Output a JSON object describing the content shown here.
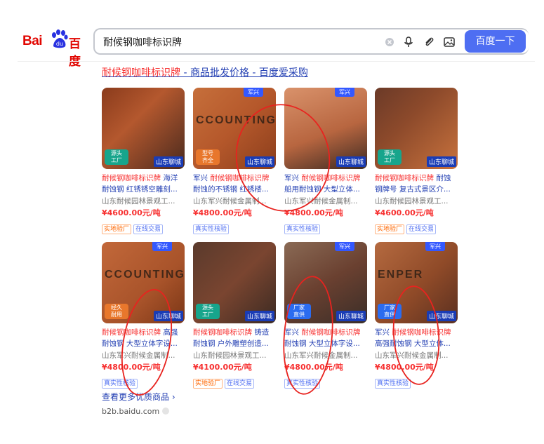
{
  "logo": {
    "bai": "Bai",
    "du": "百度"
  },
  "search": {
    "query": "耐候钢咖啡标识牌",
    "button_label": "百度一下"
  },
  "result": {
    "title_highlight": "耐候钢咖啡标识牌",
    "title_rest": " - 商品批发价格 - 百度爱采购"
  },
  "products": [
    {
      "top_tag": "",
      "badge": "源头\n工厂",
      "shop": "山东聊城",
      "desc_hl": "耐候钢咖啡标识牌",
      "desc_rest": " 海洋耐蚀钢 红锈锈空雕刻...",
      "company": "山东耐候园林景观工...",
      "price": "¥4600.00元/吨",
      "tags": [
        "实地验厂",
        "在线交易"
      ]
    },
    {
      "top_tag": "军兴",
      "badge": "型号\n齐全",
      "shop": "山东聊城",
      "desc_hl": "耐候钢咖啡标识牌",
      "desc_pre": "军兴 ",
      "desc_rest": " 耐蚀的不锈钢 红锈楼...",
      "company": "山东军兴耐候金属制...",
      "price": "¥4800.00元/吨",
      "tags": [
        "真实性核验"
      ]
    },
    {
      "top_tag": "军兴",
      "badge": "",
      "shop": "山东聊城",
      "desc_hl": "耐候钢咖啡标识牌",
      "desc_pre": "军兴 ",
      "desc_rest": " 船用耐蚀钢 大型立体...",
      "company": "山东军兴耐候金属制...",
      "price": "¥4800.00元/吨",
      "tags": [
        "真实性核验"
      ]
    },
    {
      "top_tag": "",
      "badge": "源头\n工厂",
      "shop": "山东聊城",
      "desc_hl": "耐候钢咖啡标识牌",
      "desc_rest": " 耐蚀钢牌号 复古式景区介...",
      "company": "山东耐候园林景观工...",
      "price": "¥4600.00元/吨",
      "tags": [
        "实地验厂",
        "在线交易"
      ]
    },
    {
      "top_tag": "军兴",
      "badge": "经久\n耐用",
      "shop": "山东聊城",
      "desc_hl": "耐候钢咖啡标识牌",
      "desc_rest": " 高强耐蚀钢 大型立体字设...",
      "company": "山东军兴耐候金属制...",
      "price": "¥4800.00元/吨",
      "tags": [
        "真实性核验"
      ]
    },
    {
      "top_tag": "",
      "badge": "源头\n工厂",
      "shop": "山东聊城",
      "desc_hl": "耐候钢咖啡标识牌",
      "desc_rest": " 铸造耐蚀钢 户外雕塑创造...",
      "company": "山东耐候园林景观工...",
      "price": "¥4100.00元/吨",
      "tags": [
        "实地验厂",
        "在线交易"
      ]
    },
    {
      "top_tag": "军兴",
      "badge": "厂家\n直供",
      "shop": "山东聊城",
      "desc_hl": "耐候钢咖啡标识牌",
      "desc_pre": "军兴 ",
      "desc_rest": " 耐蚀钢 大型立体字设...",
      "company": "山东军兴耐候金属制...",
      "price": "¥4800.00元/吨",
      "tags": [
        "真实性核验"
      ]
    },
    {
      "top_tag": "军兴",
      "badge": "厂家\n直供",
      "shop": "山东聊城",
      "desc_hl": "耐候钢咖啡标识牌",
      "desc_pre": "军兴 ",
      "desc_rest": " 高强耐蚀钢 大型立体...",
      "company": "山东军兴耐候金属制...",
      "price": "¥4800.00元/吨",
      "tags": [
        "真实性核验"
      ]
    }
  ],
  "footer": {
    "more": "查看更多优质商品 ›",
    "source": "b2b.baidu.com"
  },
  "colors": {
    "accent": "#4e6ef2",
    "highlight": "#f73131",
    "link": "#2440b3",
    "annotation": "#e8231f"
  }
}
